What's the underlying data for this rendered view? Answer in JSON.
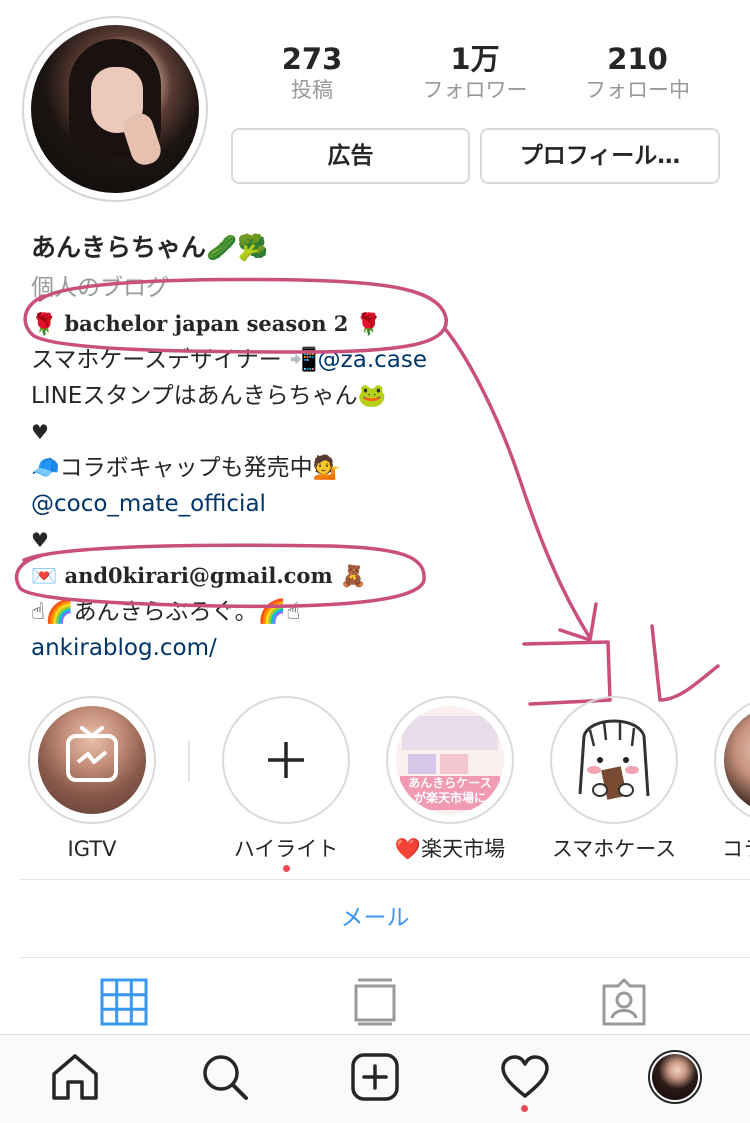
{
  "stats": {
    "posts": {
      "value": "273",
      "label": "投稿"
    },
    "followers": {
      "value": "1万",
      "label": "フォロワー"
    },
    "following": {
      "value": "210",
      "label": "フォロー中"
    }
  },
  "buttons": {
    "ad": "広告",
    "profile": "プロフィール…"
  },
  "bio": {
    "name": "あんきらちゃん🥒🥦",
    "category": "個人のブログ",
    "line1": "🌹 bachelor japan season 2 🌹",
    "line2_text": "スマホケースデザイナー 📲",
    "line2_link": "@za.case",
    "line3": "LINEスタンプはあんきらちゃん🐸",
    "line4": "♥",
    "line5": "🧢コラボキャップも発売中💁",
    "line6_link": "@coco_mate_official",
    "line7": "♥",
    "line8": "💌 and0kirari@gmail.com 🧸",
    "line9": "☝🌈あんきらぶろぐ。🌈☝",
    "website": "ankirablog.com/"
  },
  "highlights": [
    {
      "label": "IGTV"
    },
    {
      "label": "ハイライト"
    },
    {
      "label": "❤️楽天市場"
    },
    {
      "label": "スマホケース"
    },
    {
      "label": "コラ"
    }
  ],
  "highlight_thumb_text": {
    "rakuten": "あんきらケース\nが楽天市場に"
  },
  "mail_button": "メール",
  "colors": {
    "link": "#003569",
    "accent": "#3897f0",
    "annotation": "#c9507e",
    "notification": "#ed4956"
  },
  "icons": {
    "tabs": [
      "grid-icon",
      "feed-icon",
      "tagged-icon"
    ],
    "nav": [
      "home-icon",
      "search-icon",
      "add-icon",
      "heart-icon",
      "profile-avatar"
    ]
  }
}
